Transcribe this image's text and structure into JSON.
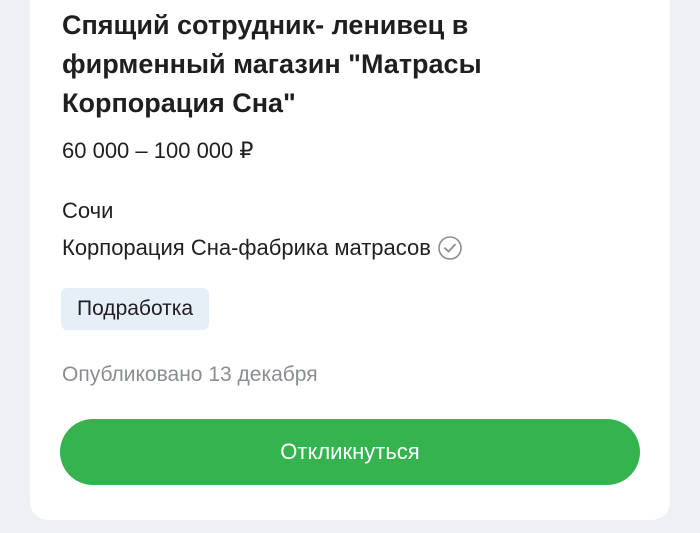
{
  "vacancy": {
    "title": "Спящий сотрудник- ленивец в фирменный магазин \"Матрасы Корпорация Сна\"",
    "salary": "60 000 – 100 000 ₽",
    "city": "Сочи",
    "company": "Корпорация Сна-фабрика матрасов",
    "verified_icon": "check-circle-icon",
    "tag": "Подработка",
    "published": "Опубликовано 13 декабря",
    "respond_label": "Откликнуться"
  },
  "colors": {
    "accent": "#35b34f",
    "tag_background": "#e6eef8",
    "secondary_text": "#8a8d91",
    "page_background": "#eef0f3"
  }
}
